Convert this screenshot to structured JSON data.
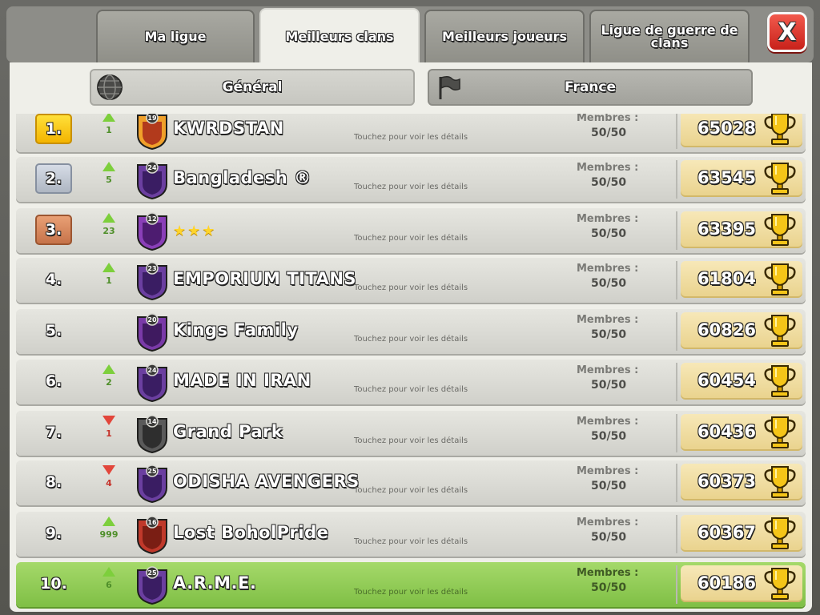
{
  "tabs": [
    {
      "label": "Ma ligue"
    },
    {
      "label": "Meilleurs clans"
    },
    {
      "label": "Meilleurs joueurs"
    },
    {
      "label": "Ligue de guerre de clans"
    }
  ],
  "close_label": "X",
  "filters": {
    "global": "Général",
    "local": "France"
  },
  "row_labels": {
    "members_label": "Membres :",
    "details": "Touchez pour voir les détails"
  },
  "clans": [
    {
      "rank": "1.",
      "trend": "up",
      "change": "1",
      "badge_level": "19",
      "name": "KWRDSTAN",
      "members": "50/50",
      "trophies": "65028"
    },
    {
      "rank": "2.",
      "trend": "up",
      "change": "5",
      "badge_level": "24",
      "name": "Bangladesh ®",
      "members": "50/50",
      "trophies": "63545"
    },
    {
      "rank": "3.",
      "trend": "up",
      "change": "23",
      "badge_level": "12",
      "name": "",
      "stars": "★★★",
      "members": "50/50",
      "trophies": "63395"
    },
    {
      "rank": "4.",
      "trend": "up",
      "change": "1",
      "badge_level": "23",
      "name": "EMPORIUM TITANS",
      "members": "50/50",
      "trophies": "61804"
    },
    {
      "rank": "5.",
      "trend": "none",
      "change": "",
      "badge_level": "20",
      "name": "Kings Family",
      "members": "50/50",
      "trophies": "60826"
    },
    {
      "rank": "6.",
      "trend": "up",
      "change": "2",
      "badge_level": "24",
      "name": "MADE IN IRAN",
      "members": "50/50",
      "trophies": "60454"
    },
    {
      "rank": "7.",
      "trend": "down",
      "change": "1",
      "badge_level": "14",
      "name": "Grand Park",
      "members": "50/50",
      "trophies": "60436"
    },
    {
      "rank": "8.",
      "trend": "down",
      "change": "4",
      "badge_level": "25",
      "name": "ODISHA AVENGERS",
      "members": "50/50",
      "trophies": "60373"
    },
    {
      "rank": "9.",
      "trend": "up",
      "change": "999",
      "badge_level": "16",
      "name": "Lost BoholPride",
      "members": "50/50",
      "trophies": "60367"
    },
    {
      "rank": "10.",
      "trend": "up",
      "change": "6",
      "badge_level": "25",
      "name": "A.R.M.E.",
      "members": "50/50",
      "trophies": "60186"
    }
  ],
  "colors": {
    "accent_green": "#7fbf45",
    "close_red": "#d8261d",
    "gold": "#f3b400"
  },
  "icons": {
    "globe": "globe-icon",
    "flag": "flag-icon",
    "trophy": "trophy-icon",
    "up": "trend-up-arrow-icon",
    "down": "trend-down-arrow-icon"
  }
}
